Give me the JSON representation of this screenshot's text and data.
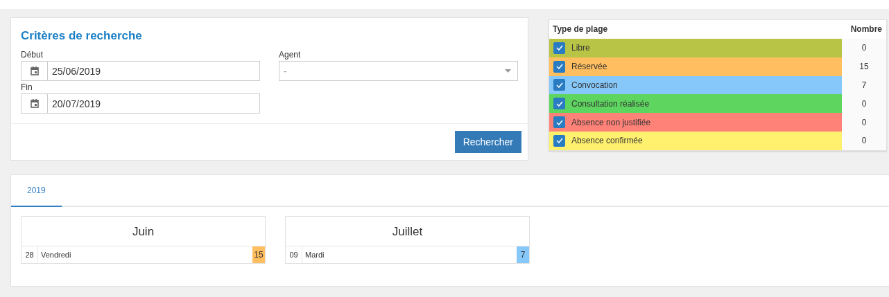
{
  "search": {
    "title": "Critères de recherche",
    "fields": [
      {
        "label": "Début",
        "value": "25/06/2019"
      },
      {
        "label": "Fin",
        "value": "20/07/2019"
      }
    ],
    "agent": {
      "label": "Agent",
      "placeholder": "-"
    },
    "button": "Rechercher"
  },
  "legend": {
    "columns": [
      "Type de plage",
      "Nombre"
    ],
    "rows": [
      {
        "label": "Libre",
        "count": "0",
        "checked": true,
        "color": "#b8c446"
      },
      {
        "label": "Réservée",
        "count": "15",
        "checked": true,
        "color": "#ffbe5f"
      },
      {
        "label": "Convocation",
        "count": "7",
        "checked": true,
        "color": "#87c8fb"
      },
      {
        "label": "Consultation réalisée",
        "count": "0",
        "checked": true,
        "color": "#5dd55f"
      },
      {
        "label": "Absence non justifiée",
        "count": "0",
        "checked": true,
        "color": "#ff8278"
      },
      {
        "label": "Absence confirmée",
        "count": "0",
        "checked": true,
        "color": "#fff06e"
      }
    ]
  },
  "tabs": [
    {
      "label": "2019",
      "selected": true
    }
  ],
  "months": [
    {
      "name": "Juin",
      "days": [
        {
          "day": "28",
          "weekday": "Vendredi",
          "count": "15",
          "color": "#ffbe5f"
        }
      ]
    },
    {
      "name": "Juillet",
      "days": [
        {
          "day": "09",
          "weekday": "Mardi",
          "count": "7",
          "color": "#87c8fb"
        }
      ]
    }
  ]
}
